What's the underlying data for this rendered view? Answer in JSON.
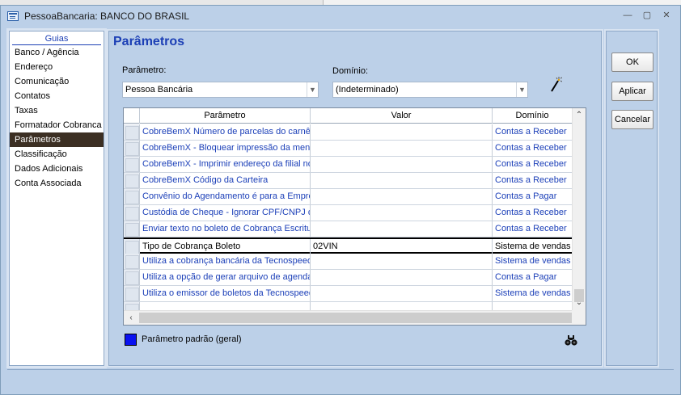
{
  "window": {
    "title": "PessoaBancaria: BANCO DO BRASIL",
    "minimize": "—",
    "maximize": "▢",
    "close": "✕"
  },
  "sidebar": {
    "header": "Guias",
    "items": [
      {
        "label": "Banco / Agência",
        "selected": false
      },
      {
        "label": "Endereço",
        "selected": false
      },
      {
        "label": "Comunicação",
        "selected": false
      },
      {
        "label": "Contatos",
        "selected": false
      },
      {
        "label": "Taxas",
        "selected": false
      },
      {
        "label": "Formatador Cobranca",
        "selected": false
      },
      {
        "label": "Parâmetros",
        "selected": true
      },
      {
        "label": "Classificação",
        "selected": false
      },
      {
        "label": "Dados Adicionais",
        "selected": false
      },
      {
        "label": "Conta Associada",
        "selected": false
      }
    ]
  },
  "main": {
    "title": "Parâmetros",
    "parametro_label": "Parâmetro:",
    "parametro_value": "Pessoa Bancária",
    "dominio_label": "Domínio:",
    "dominio_value": "(Indeterminado)",
    "icons": {
      "wand": "magic-wand-icon",
      "find": "binoculars-icon"
    }
  },
  "grid": {
    "columns": [
      "Parâmetro",
      "Valor",
      "Domínio"
    ],
    "rows": [
      {
        "parametro": "CobreBemX  Número de parcelas do carnê",
        "valor": "",
        "dominio": "Contas a Receber",
        "type": "std"
      },
      {
        "parametro": "CobreBemX - Bloquear impressão da mensagem",
        "valor": "",
        "dominio": "Contas a Receber",
        "type": "std"
      },
      {
        "parametro": "CobreBemX - Imprimir endereço da filial no boleto",
        "valor": "",
        "dominio": "Contas a Receber",
        "type": "std"
      },
      {
        "parametro": "CobreBemX Código da Carteira",
        "valor": "",
        "dominio": "Contas a Receber",
        "type": "std"
      },
      {
        "parametro": "Convênio do Agendamento é para a Empresa",
        "valor": "",
        "dominio": "Contas a Pagar",
        "type": "std"
      },
      {
        "parametro": "Custódia de Cheque - Ignorar CPF/CNPJ do cheque",
        "valor": "",
        "dominio": "Contas a Receber",
        "type": "std"
      },
      {
        "parametro": "Enviar texto no boleto de Cobrança Escritural",
        "valor": "",
        "dominio": "Contas a Receber",
        "type": "std"
      },
      {
        "parametro": "Tipo de Cobrança Boleto",
        "valor": "02VIN",
        "dominio": "Sistema de vendas",
        "type": "active"
      },
      {
        "parametro": "Utiliza a cobrança bancária da Tecnospeed",
        "valor": "",
        "dominio": "Sistema de vendas",
        "type": "std"
      },
      {
        "parametro": "Utiliza a opção de gerar arquivo de agendamento",
        "valor": "",
        "dominio": "Contas a Pagar",
        "type": "std"
      },
      {
        "parametro": "Utiliza o emissor de boletos da Tecnospeed",
        "valor": "",
        "dominio": "Sistema de vendas",
        "type": "std"
      }
    ]
  },
  "legend": {
    "label": "Parâmetro padrão (geral)",
    "color": "#0a12f0"
  },
  "buttons": {
    "ok": "OK",
    "apply": "Aplicar",
    "cancel": "Cancelar"
  }
}
